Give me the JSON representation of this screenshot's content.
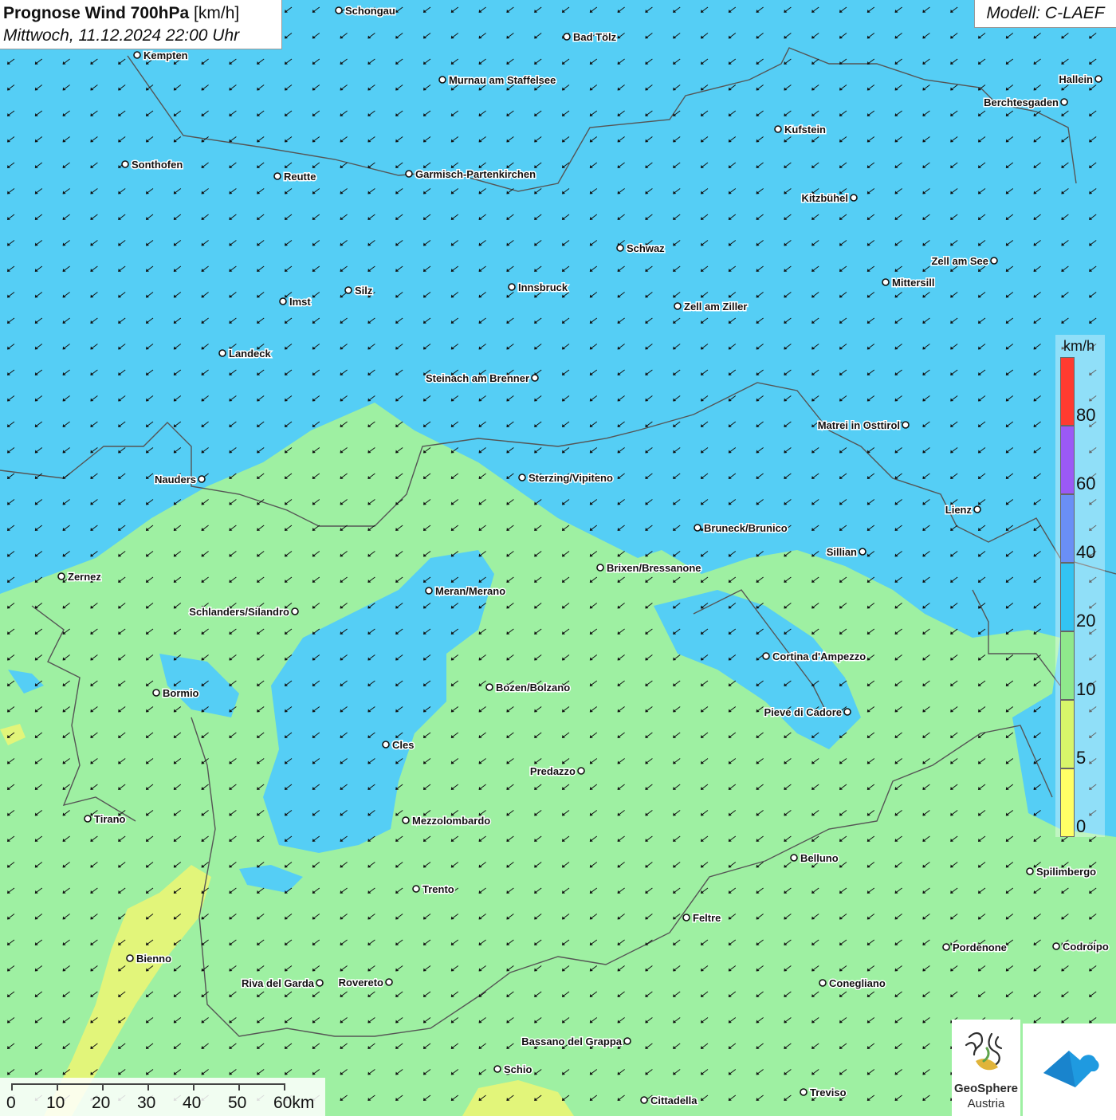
{
  "header": {
    "title_bold": "Prognose Wind 700hPa",
    "title_unit": " [km/h]",
    "subtitle": "Mittwoch, 11.12.2024 22:00 Uhr",
    "model": "Modell: C-LAEF"
  },
  "legend": {
    "unit": "km/h",
    "ticks": [
      "80",
      "60",
      "40",
      "20",
      "10",
      "5",
      "0"
    ],
    "bins": [
      {
        "color": "#ff3b30"
      },
      {
        "color": "#9b59f5"
      },
      {
        "color": "#6a8ff5"
      },
      {
        "color": "#33c4f2"
      },
      {
        "color": "#8fe88c"
      },
      {
        "color": "#d8f56a"
      },
      {
        "color": "#ffff66"
      }
    ]
  },
  "scale_bar": {
    "labels": [
      "0",
      "10",
      "20",
      "30",
      "40",
      "50",
      "60km"
    ]
  },
  "logos": {
    "geosphere_name": "GeoSphere",
    "geosphere_sub": "Austria"
  },
  "colors": {
    "wind_10_20": "#55cef5",
    "wind_5_10": "#9ef0a2",
    "wind_0_5": "#e2f57a",
    "border": "#555555",
    "arrow": "#111111"
  },
  "wind": {
    "direction": "north-east",
    "dominant_speed_band": "10–20 km/h"
  },
  "cities": [
    {
      "name": "Schongau"
    },
    {
      "name": "Bad Tölz"
    },
    {
      "name": "Kempten"
    },
    {
      "name": "Murnau am Staffelsee"
    },
    {
      "name": "Hallein"
    },
    {
      "name": "Berchtesgaden"
    },
    {
      "name": "Kufstein"
    },
    {
      "name": "Sonthofen"
    },
    {
      "name": "Reutte"
    },
    {
      "name": "Garmisch-Partenkirchen"
    },
    {
      "name": "Kitzbühel"
    },
    {
      "name": "Schwaz"
    },
    {
      "name": "Zell am See"
    },
    {
      "name": "Mittersill"
    },
    {
      "name": "Silz"
    },
    {
      "name": "Innsbruck"
    },
    {
      "name": "Imst"
    },
    {
      "name": "Zell am Ziller"
    },
    {
      "name": "Landeck"
    },
    {
      "name": "Steinach am Brenner"
    },
    {
      "name": "Matrei in Osttirol"
    },
    {
      "name": "Nauders"
    },
    {
      "name": "Sterzing/Vipiteno"
    },
    {
      "name": "Lienz"
    },
    {
      "name": "Bruneck/Brunico"
    },
    {
      "name": "Sillian"
    },
    {
      "name": "Brixen/Bressanone"
    },
    {
      "name": "Zernez"
    },
    {
      "name": "Meran/Merano"
    },
    {
      "name": "Schlanders/Silandro"
    },
    {
      "name": "Cortina d'Ampezzo"
    },
    {
      "name": "Bozen/Bolzano"
    },
    {
      "name": "Bormio"
    },
    {
      "name": "Pieve di Cadore"
    },
    {
      "name": "Cles"
    },
    {
      "name": "Predazzo"
    },
    {
      "name": "Tirano"
    },
    {
      "name": "Mezzolombardo"
    },
    {
      "name": "Belluno"
    },
    {
      "name": "Spilimbergo"
    },
    {
      "name": "Trento"
    },
    {
      "name": "Feltre"
    },
    {
      "name": "Pordenone"
    },
    {
      "name": "Codroipo"
    },
    {
      "name": "Bienno"
    },
    {
      "name": "Riva del Garda"
    },
    {
      "name": "Rovereto"
    },
    {
      "name": "Conegliano"
    },
    {
      "name": "Bassano del Grappa"
    },
    {
      "name": "Schio"
    },
    {
      "name": "Treviso"
    },
    {
      "name": "Cittadella"
    }
  ]
}
